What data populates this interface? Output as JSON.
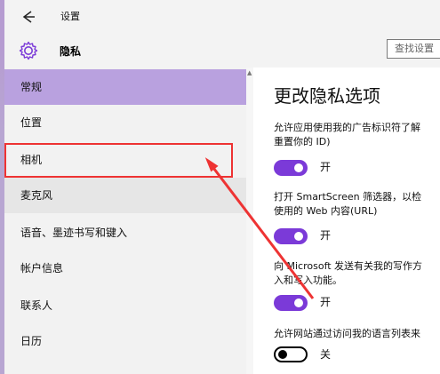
{
  "window": {
    "title": "设置",
    "page_title": "隐私",
    "search_placeholder": "查找设置"
  },
  "sidebar": {
    "items": [
      {
        "label": "常规",
        "state": "selected"
      },
      {
        "label": "位置",
        "state": "normal"
      },
      {
        "label": "相机",
        "state": "normal"
      },
      {
        "label": "麦克风",
        "state": "hover"
      },
      {
        "label": "语音、墨迹书写和键入",
        "state": "normal"
      },
      {
        "label": "帐户信息",
        "state": "normal"
      },
      {
        "label": "联系人",
        "state": "normal"
      },
      {
        "label": "日历",
        "state": "normal"
      }
    ]
  },
  "main": {
    "title": "更改隐私选项",
    "settings": [
      {
        "desc_lines": [
          "允许应用使用我的广告标识符了解",
          "重置你的 ID)"
        ],
        "toggle": "on",
        "toggle_label": "开"
      },
      {
        "desc_lines": [
          "打开 SmartScreen 筛选器，以检",
          "使用的 Web 内容(URL)"
        ],
        "toggle": "on",
        "toggle_label": "开"
      },
      {
        "desc_lines": [
          "向 Microsoft 发送有关我的写作方",
          "入和写入功能。"
        ],
        "toggle": "on",
        "toggle_label": "开"
      },
      {
        "desc_lines": [
          "允许网站通过访问我的语言列表来"
        ],
        "toggle": "off",
        "toggle_label": "关"
      }
    ]
  },
  "colors": {
    "accent": "#7b3ad8",
    "selected_nav": "#b9a1df",
    "annotation_red": "#e33333"
  },
  "icons": [
    "back-arrow-icon",
    "gear-icon"
  ]
}
